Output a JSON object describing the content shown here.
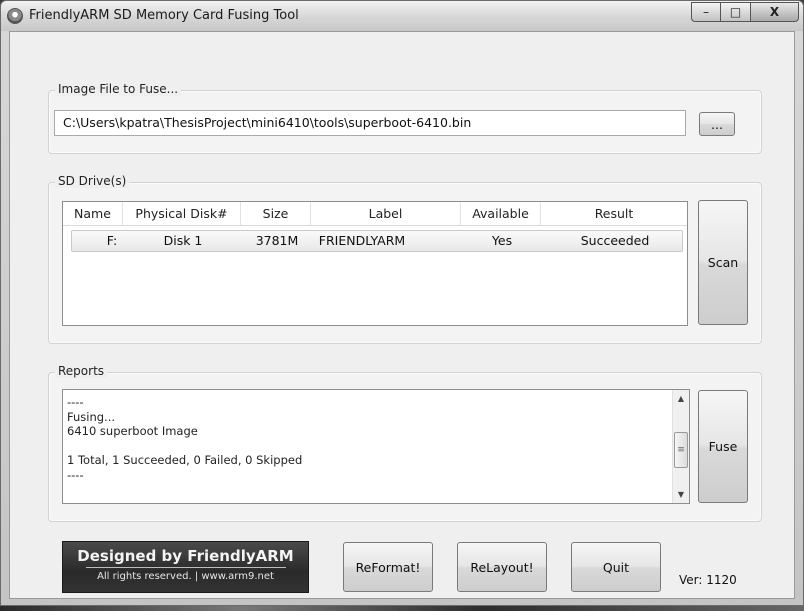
{
  "window": {
    "title": "FriendlyARM SD Memory Card Fusing Tool",
    "controls": {
      "minimize": "–",
      "maximize": "□",
      "close": "X"
    }
  },
  "image_file": {
    "legend": "Image File to Fuse...",
    "path": "C:\\Users\\kpatra\\ThesisProject\\mini6410\\tools\\superboot-6410.bin",
    "browse_label": "..."
  },
  "sd_drives": {
    "legend": "SD Drive(s)",
    "columns": [
      "Name",
      "Physical Disk#",
      "Size",
      "Label",
      "Available",
      "Result"
    ],
    "rows": [
      {
        "name": "F:",
        "disk": "Disk 1",
        "size": "3781M",
        "label": "FRIENDLYARM",
        "available": "Yes",
        "result": "Succeeded"
      }
    ],
    "scan_label": "Scan"
  },
  "reports": {
    "legend": "Reports",
    "lines": [
      "----",
      "Fusing...",
      "6410 superboot Image",
      "",
      "1 Total, 1 Succeeded, 0 Failed, 0 Skipped",
      "----"
    ],
    "fuse_label": "Fuse"
  },
  "footer": {
    "logo_main": "Designed by FriendlyARM",
    "logo_sub": "All rights reserved. | www.arm9.net",
    "reformat_label": "ReFormat!",
    "relayout_label": "ReLayout!",
    "quit_label": "Quit",
    "version": "Ver: 1120"
  }
}
